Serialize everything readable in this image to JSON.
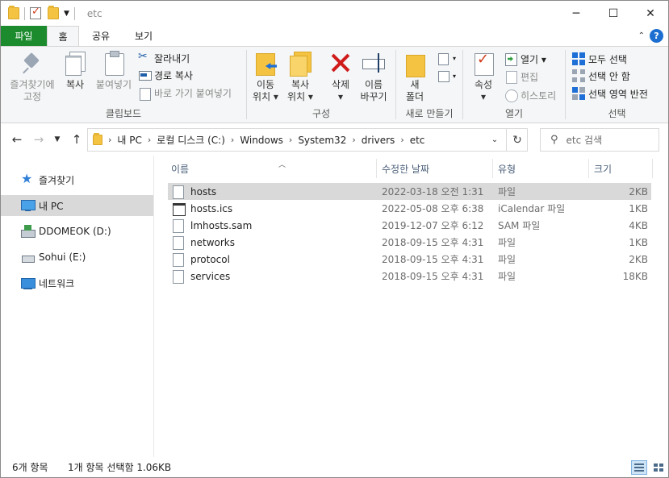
{
  "window": {
    "title": "etc",
    "minimize": "─",
    "maximize": "☐",
    "close": "✕"
  },
  "ribbon_tabs": {
    "file": "파일",
    "home": "홈",
    "share": "공유",
    "view": "보기"
  },
  "clipboard": {
    "pin": "즐겨찾기에\n고정",
    "copy": "복사",
    "paste": "붙여넣기",
    "cut": "잘라내기",
    "copy_path": "경로 복사",
    "paste_shortcut": "바로 가기 붙여넣기",
    "label": "클립보드"
  },
  "organize": {
    "move_to": "이동\n위치 ▾",
    "copy_to": "복사\n위치 ▾",
    "delete": "삭제\n▾",
    "rename": "이름\n바꾸기",
    "label": "구성"
  },
  "new": {
    "new_folder": "새\n폴더",
    "label": "새로 만들기"
  },
  "open": {
    "properties": "속성\n▾",
    "open": "열기 ▾",
    "edit": "편집",
    "history": "히스토리",
    "label": "열기"
  },
  "select": {
    "select_all": "모두 선택",
    "select_none": "선택 안 함",
    "invert": "선택 영역 반전",
    "label": "선택"
  },
  "address": {
    "crumbs": [
      "내 PC",
      "로컬 디스크 (C:)",
      "Windows",
      "System32",
      "drivers",
      "etc"
    ],
    "search_placeholder": "etc 검색"
  },
  "nav_pane": {
    "items": [
      {
        "label": "즐겨찾기",
        "icon": "star-icon"
      },
      {
        "label": "내 PC",
        "icon": "pc-icon",
        "selected": true
      },
      {
        "label": "DDOMEOK (D:)",
        "icon": "drive-icon"
      },
      {
        "label": "Sohui (E:)",
        "icon": "usb-drive-icon"
      },
      {
        "label": "네트워크",
        "icon": "network-icon"
      }
    ]
  },
  "columns": {
    "name": "이름",
    "date": "수정한 날짜",
    "type": "유형",
    "size": "크기"
  },
  "files": [
    {
      "name": "hosts",
      "date": "2022-03-18 오전 1:31",
      "type": "파일",
      "size": "2KB",
      "selected": true
    },
    {
      "name": "hosts.ics",
      "date": "2022-05-08 오후 6:38",
      "type": "iCalendar 파일",
      "size": "1KB"
    },
    {
      "name": "lmhosts.sam",
      "date": "2019-12-07 오후 6:12",
      "type": "SAM 파일",
      "size": "4KB"
    },
    {
      "name": "networks",
      "date": "2018-09-15 오후 4:31",
      "type": "파일",
      "size": "1KB"
    },
    {
      "name": "protocol",
      "date": "2018-09-15 오후 4:31",
      "type": "파일",
      "size": "2KB"
    },
    {
      "name": "services",
      "date": "2018-09-15 오후 4:31",
      "type": "파일",
      "size": "18KB"
    }
  ],
  "status": {
    "count": "6개 항목",
    "selection": "1개 항목 선택함 1.06KB"
  },
  "colors": {
    "file_tab": "#1c8b2e",
    "selection": "#d9d9d9",
    "accent": "#1f70d6"
  }
}
